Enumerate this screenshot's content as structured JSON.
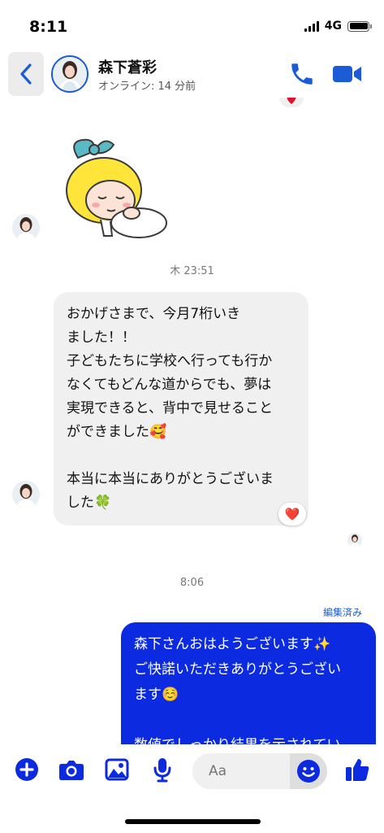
{
  "status_bar": {
    "time": "8:11",
    "network": "4G"
  },
  "header": {
    "name": "森下蒼彩",
    "presence": "オンライン: 14 分前"
  },
  "messages": {
    "timestamp_1": "木 23:51",
    "incoming_text": "おかげさまで、今月7桁いき\nました！！\n子どもたちに学校へ行っても行か\nなくてもどんな道からでも、夢は\n実現できると、背中で見せること\nができました🥰\n\n本当に本当にありがとうございま\nした🍀",
    "reaction": "❤️",
    "timestamp_2": "8:06",
    "edited_label": "編集済み",
    "outgoing_text": "森下さんおはようございます✨\nご快諾いただきありがとうござい\nます☺️\n\n数値でしっかり結果を示されてい"
  },
  "composer": {
    "placeholder": "Aa"
  },
  "icons": {
    "back": "chevron-left-icon",
    "call": "phone-icon",
    "video": "video-camera-icon",
    "add": "plus-circle-icon",
    "camera": "camera-icon",
    "gallery": "image-icon",
    "mic": "microphone-icon",
    "emoji": "smiley-icon",
    "like": "thumbs-up-icon"
  },
  "colors": {
    "accent": "#1c5bd6",
    "outgoing_bubble": "#0c2ae0",
    "incoming_bubble": "#f0f0f0",
    "heart": "#e0112b"
  }
}
